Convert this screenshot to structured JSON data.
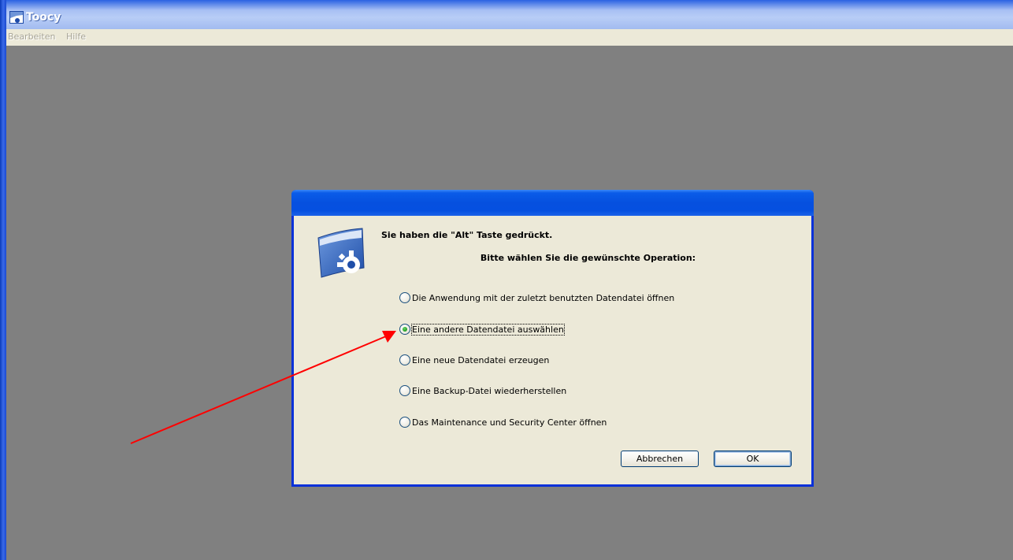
{
  "window": {
    "title": "Toocy"
  },
  "menubar": {
    "items": [
      "Bearbeiten",
      "Hilfe"
    ]
  },
  "dialog": {
    "heading": "Sie haben die \"Alt\" Taste gedrückt.",
    "subheading": "Bitte wählen Sie die gewünschte Operation:",
    "options": [
      {
        "label": "Die Anwendung mit der zuletzt benutzten Datendatei öffnen",
        "checked": false
      },
      {
        "label": "Eine andere Datendatei auswählen",
        "checked": true
      },
      {
        "label": "Eine neue Datendatei erzeugen",
        "checked": false
      },
      {
        "label": "Eine Backup-Datei wiederherstellen",
        "checked": false
      },
      {
        "label": "Das Maintenance und Security Center öffnen",
        "checked": false
      }
    ],
    "buttons": {
      "cancel": "Abbrechen",
      "ok": "OK"
    }
  },
  "colors": {
    "workspace": "#808080",
    "dialog_frame": "#0831d9",
    "dialog_body": "#ece9d8",
    "annotation_arrow": "#ff0000"
  }
}
